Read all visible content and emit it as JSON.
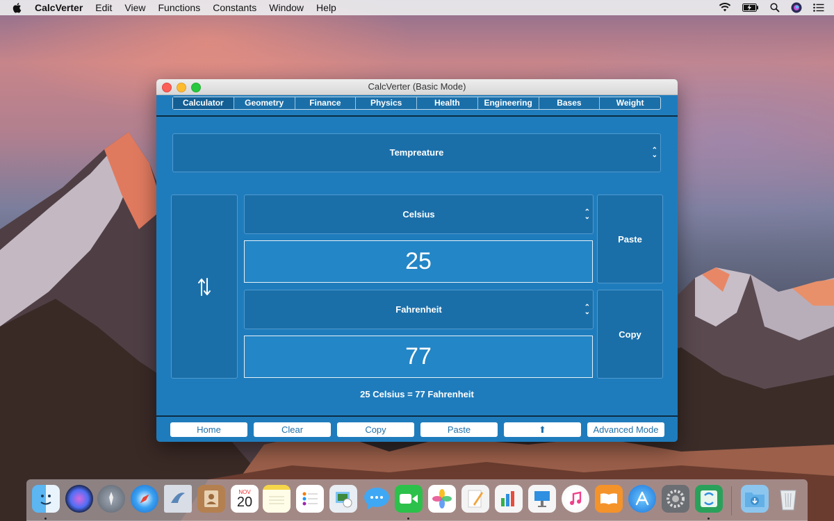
{
  "menubar": {
    "app_name": "CalcVerter",
    "items": [
      "Edit",
      "View",
      "Functions",
      "Constants",
      "Window",
      "Help"
    ]
  },
  "window": {
    "title": "CalcVerter (Basic Mode)",
    "tabs": [
      "Calculator",
      "Geometry",
      "Finance",
      "Physics",
      "Health",
      "Engineering",
      "Bases",
      "Weight"
    ],
    "active_tab": "Calculator",
    "category": "Tempreature",
    "from_unit": "Celsius",
    "from_value": "25",
    "to_unit": "Fahrenheit",
    "to_value": "77",
    "swap_icon": "swap-vertical-arrows-icon",
    "paste_label": "Paste",
    "copy_label": "Copy",
    "result_text": "25 Celsius = 77 Fahrenheit",
    "bottom_buttons": {
      "home": "Home",
      "clear": "Clear",
      "copy": "Copy",
      "paste": "Paste",
      "up": "⬆",
      "advanced": "Advanced Mode"
    }
  },
  "dock": {
    "calendar_month": "NOV",
    "calendar_day": "20",
    "apps": [
      "finder",
      "siri",
      "launchpad",
      "safari",
      "mail",
      "contacts",
      "calendar",
      "notes",
      "reminders",
      "preview",
      "messages",
      "facetime",
      "photos",
      "pages",
      "numbers",
      "keynote",
      "itunes",
      "ibooks",
      "app-store",
      "system-preferences",
      "calcverter",
      "downloads",
      "trash"
    ]
  },
  "colors": {
    "window_bg": "#1f7cbc",
    "panel_bg": "#1b6fa9",
    "accent_text": "#1f6fa8"
  }
}
